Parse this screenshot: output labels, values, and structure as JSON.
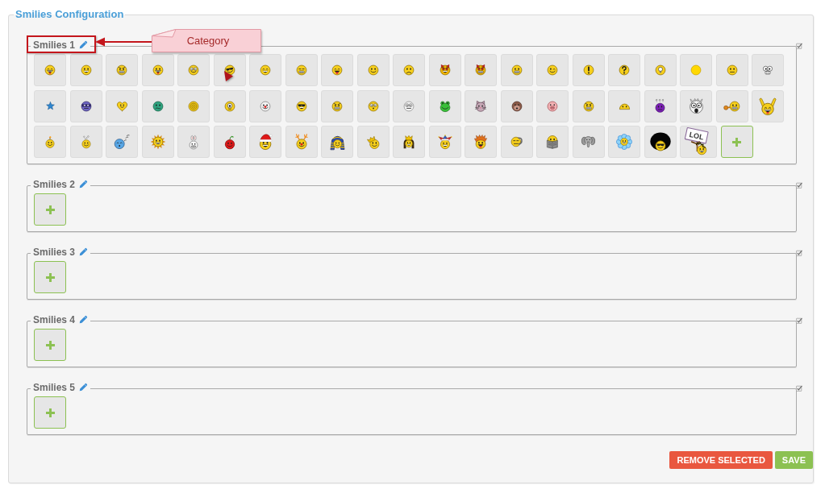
{
  "panel": {
    "title": "Smilies Configuration"
  },
  "annotation": {
    "callout": "Category"
  },
  "categories": [
    {
      "name": "Smilies 1",
      "smilies": [
        {
          "kind": "laugh",
          "selected": false
        },
        {
          "kind": "grin",
          "selected": false
        },
        {
          "kind": "grimace",
          "selected": false
        },
        {
          "kind": "happy",
          "selected": false
        },
        {
          "kind": "nerd",
          "selected": false
        },
        {
          "kind": "shades",
          "selected": false
        },
        {
          "kind": "chuckle",
          "selected": false
        },
        {
          "kind": "clench",
          "selected": false
        },
        {
          "kind": "tongue",
          "selected": false
        },
        {
          "kind": "smile",
          "selected": false
        },
        {
          "kind": "sad",
          "selected": false
        },
        {
          "kind": "devil",
          "selected": false
        },
        {
          "kind": "fury",
          "selected": false
        },
        {
          "kind": "cheese",
          "selected": false
        },
        {
          "kind": "wink",
          "selected": false
        },
        {
          "kind": "exclaim",
          "selected": false
        },
        {
          "kind": "question",
          "selected": false
        },
        {
          "kind": "idea",
          "selected": false
        },
        {
          "kind": "blank",
          "selected": false
        },
        {
          "kind": "neutral",
          "selected": false
        },
        {
          "kind": "googly",
          "selected": false
        },
        {
          "kind": "star",
          "selected": false
        },
        {
          "kind": "ninja",
          "selected": false
        },
        {
          "kind": "heart",
          "selected": false
        },
        {
          "kind": "sick",
          "selected": false
        },
        {
          "kind": "dizzy",
          "selected": false
        },
        {
          "kind": "cyclops",
          "selected": false
        },
        {
          "kind": "clown",
          "selected": false
        },
        {
          "kind": "cool",
          "selected": false
        },
        {
          "kind": "teeth",
          "selected": false
        },
        {
          "kind": "surprised",
          "selected": false
        },
        {
          "kind": "pale",
          "selected": false
        },
        {
          "kind": "frog",
          "selected": false
        },
        {
          "kind": "cat",
          "selected": false
        },
        {
          "kind": "monkey",
          "selected": false
        },
        {
          "kind": "pig",
          "selected": false
        },
        {
          "kind": "teeth",
          "selected": false
        },
        {
          "kind": "peek",
          "selected": false
        },
        {
          "kind": "confused",
          "selected": false
        },
        {
          "kind": "scream",
          "selected": false
        },
        {
          "kind": "fist",
          "selected": false
        },
        {
          "kind": "cheer",
          "selected": false
        },
        {
          "kind": "fuse",
          "selected": false
        },
        {
          "kind": "bubbles",
          "selected": false
        },
        {
          "kind": "sleep",
          "selected": false
        },
        {
          "kind": "sun",
          "selected": false
        },
        {
          "kind": "bunny",
          "selected": false
        },
        {
          "kind": "cherry",
          "selected": false
        },
        {
          "kind": "santa",
          "selected": false
        },
        {
          "kind": "reindeer",
          "selected": false
        },
        {
          "kind": "pharaoh",
          "selected": false
        },
        {
          "kind": "king",
          "selected": false
        },
        {
          "kind": "queen",
          "selected": false
        },
        {
          "kind": "jester",
          "selected": false
        },
        {
          "kind": "punk",
          "selected": false
        },
        {
          "kind": "phone",
          "selected": false
        },
        {
          "kind": "reader",
          "selected": false
        },
        {
          "kind": "elephant",
          "selected": false
        },
        {
          "kind": "flower",
          "selected": false
        },
        {
          "kind": "afro",
          "selected": false
        },
        {
          "kind": "sign",
          "text": "LOL",
          "selected": false
        }
      ]
    },
    {
      "name": "Smilies 2"
    },
    {
      "name": "Smilies 3"
    },
    {
      "name": "Smilies 4"
    },
    {
      "name": "Smilies 5"
    }
  ],
  "buttons": [
    {
      "label": "REMOVE SELECTED",
      "kind": "danger"
    },
    {
      "label": "SAVE",
      "kind": "success"
    }
  ]
}
